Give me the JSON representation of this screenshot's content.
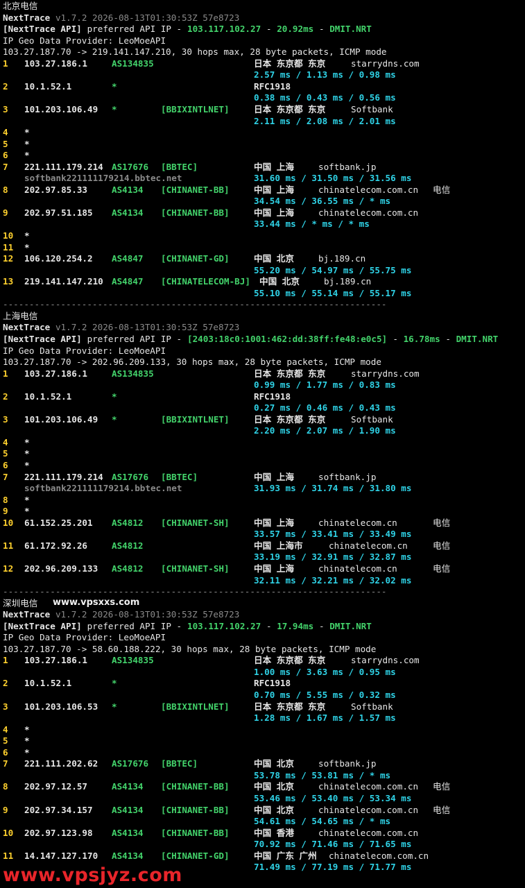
{
  "blocks": [
    {
      "title": "北京电信",
      "nt_name": "NextTrace",
      "nt_meta": "v1.7.2 2026-08-13T01:30:53Z 57e8723",
      "api_prefix": "[NextTrace API]",
      "api_text": " preferred API IP - ",
      "api_ip": "103.117.102.27",
      "api_sep": " - ",
      "api_ms": "20.92ms",
      "api_sep2": " - ",
      "api_node": "DMIT.NRT",
      "geo": "IP Geo Data Provider: LeoMoeAPI",
      "route": "103.27.187.70 -> 219.141.147.210, 30 hops max, 28 byte packets, ICMP mode",
      "hops": [
        {
          "n": "1",
          "ip": "103.27.186.1",
          "as": "AS134835",
          "tag": "",
          "loc": "日本 东京都 东京",
          "host": "starrydns.com",
          "extra": "",
          "rtt": "2.57 ms / 1.13 ms / 0.98 ms",
          "rdns": ""
        },
        {
          "n": "2",
          "ip": "10.1.52.1",
          "as": "*",
          "tag": "",
          "loc": "RFC1918",
          "host": "",
          "extra": "",
          "rtt": "0.38 ms / 0.43 ms / 0.56 ms",
          "rdns": ""
        },
        {
          "n": "3",
          "ip": "101.203.106.49",
          "as": "*",
          "tag": "[BBIXINTLNET]",
          "loc": "日本 东京都 东京",
          "host": "Softbank",
          "extra": "",
          "rtt": "2.11 ms / 2.08 ms / 2.01 ms",
          "rdns": ""
        },
        {
          "n": "4",
          "star": "*"
        },
        {
          "n": "5",
          "star": "*"
        },
        {
          "n": "6",
          "star": "*"
        },
        {
          "n": "7",
          "ip": "221.111.179.214",
          "as": "AS17676",
          "tag": "[BBTEC]",
          "loc": "中国 上海",
          "host": "softbank.jp",
          "extra": "",
          "rtt": "31.60 ms / 31.50 ms / 31.56 ms",
          "rdns": "softbank221111179214.bbtec.net"
        },
        {
          "n": "8",
          "ip": "202.97.85.33",
          "as": "AS4134",
          "tag": "[CHINANET-BB]",
          "loc": "中国 上海",
          "host": "chinatelecom.com.cn",
          "extra": "电信",
          "rtt": "34.54 ms / 36.55 ms / * ms",
          "rdns": ""
        },
        {
          "n": "9",
          "ip": "202.97.51.185",
          "as": "AS4134",
          "tag": "[CHINANET-BB]",
          "loc": "中国 上海",
          "host": "chinatelecom.com.cn",
          "extra": "",
          "rtt": "33.44 ms / * ms / * ms",
          "rdns": ""
        },
        {
          "n": "10",
          "star": "*"
        },
        {
          "n": "11",
          "star": "*"
        },
        {
          "n": "12",
          "ip": "106.120.254.2",
          "as": "AS4847",
          "tag": "[CHINANET-GD]",
          "loc": "中国 北京",
          "host": "bj.189.cn",
          "extra": "",
          "rtt": "55.20 ms / 54.97 ms / 55.75 ms",
          "rdns": ""
        },
        {
          "n": "13",
          "ip": "219.141.147.210",
          "as": "AS4847",
          "tag": "[CHINATELECOM-BJ]",
          "loc": "中国 北京",
          "host": "bj.189.cn",
          "extra": "",
          "rtt": "55.10 ms / 55.14 ms / 55.17 ms",
          "rdns": "",
          "wide": true
        }
      ]
    },
    {
      "title": "上海电信",
      "nt_name": "NextTrace",
      "nt_meta": "v1.7.2 2026-08-13T01:30:53Z 57e8723",
      "api_prefix": "[NextTrace API]",
      "api_text": " preferred API IP - ",
      "api_ip": "[2403:18c0:1001:462:dd:38ff:fe48:e0c5]",
      "api_sep": " - ",
      "api_ms": "16.78ms",
      "api_sep2": " - ",
      "api_node": "DMIT.NRT",
      "geo": "IP Geo Data Provider: LeoMoeAPI",
      "route": "103.27.187.70 -> 202.96.209.133, 30 hops max, 28 byte packets, ICMP mode",
      "hops": [
        {
          "n": "1",
          "ip": "103.27.186.1",
          "as": "AS134835",
          "tag": "",
          "loc": "日本 东京都 东京",
          "host": "starrydns.com",
          "extra": "",
          "rtt": "0.99 ms / 1.77 ms / 0.83 ms",
          "rdns": ""
        },
        {
          "n": "2",
          "ip": "10.1.52.1",
          "as": "*",
          "tag": "",
          "loc": "RFC1918",
          "host": "",
          "extra": "",
          "rtt": "0.27 ms / 0.46 ms / 0.43 ms",
          "rdns": ""
        },
        {
          "n": "3",
          "ip": "101.203.106.49",
          "as": "*",
          "tag": "[BBIXINTLNET]",
          "loc": "日本 东京都 东京",
          "host": "Softbank",
          "extra": "",
          "rtt": "2.20 ms / 2.07 ms / 1.90 ms",
          "rdns": ""
        },
        {
          "n": "4",
          "star": "*"
        },
        {
          "n": "5",
          "star": "*"
        },
        {
          "n": "6",
          "star": "*"
        },
        {
          "n": "7",
          "ip": "221.111.179.214",
          "as": "AS17676",
          "tag": "[BBTEC]",
          "loc": "中国 上海",
          "host": "softbank.jp",
          "extra": "",
          "rtt": "31.93 ms / 31.74 ms / 31.80 ms",
          "rdns": "softbank221111179214.bbtec.net"
        },
        {
          "n": "8",
          "star": "*"
        },
        {
          "n": "9",
          "star": "*"
        },
        {
          "n": "10",
          "ip": "61.152.25.201",
          "as": "AS4812",
          "tag": "[CHINANET-SH]",
          "loc": "中国 上海",
          "host": "chinatelecom.cn",
          "extra": "电信",
          "rtt": "33.57 ms / 33.41 ms / 33.49 ms",
          "rdns": ""
        },
        {
          "n": "11",
          "ip": "61.172.92.26",
          "as": "AS4812",
          "tag": "",
          "loc": "中国 上海市",
          "host": "chinatelecom.cn",
          "extra": "电信",
          "rtt": "33.19 ms / 32.91 ms / 32.87 ms",
          "rdns": "",
          "loc_wide": true
        },
        {
          "n": "12",
          "ip": "202.96.209.133",
          "as": "AS4812",
          "tag": "[CHINANET-SH]",
          "loc": "中国 上海",
          "host": "chinatelecom.cn",
          "extra": "电信",
          "rtt": "32.11 ms / 32.21 ms / 32.02 ms",
          "rdns": ""
        }
      ]
    },
    {
      "title": "深圳电信",
      "nt_name": "NextTrace",
      "nt_meta": "v1.7.2 2026-08-13T01:30:53Z 57e8723",
      "api_prefix": "[NextTrace API]",
      "api_text": " preferred API IP - ",
      "api_ip": "103.117.102.27",
      "api_sep": " - ",
      "api_ms": "17.94ms",
      "api_sep2": " - ",
      "api_node": "DMIT.NRT",
      "geo": "IP Geo Data Provider: LeoMoeAPI",
      "route": "103.27.187.70 -> 58.60.188.222, 30 hops max, 28 byte packets, ICMP mode",
      "hops": [
        {
          "n": "1",
          "ip": "103.27.186.1",
          "as": "AS134835",
          "tag": "",
          "loc": "日本 东京都 东京",
          "host": "starrydns.com",
          "extra": "",
          "rtt": "1.00 ms / 3.63 ms / 0.95 ms",
          "rdns": ""
        },
        {
          "n": "2",
          "ip": "10.1.52.1",
          "as": "*",
          "tag": "",
          "loc": "RFC1918",
          "host": "",
          "extra": "",
          "rtt": "0.70 ms / 5.55 ms / 0.32 ms",
          "rdns": ""
        },
        {
          "n": "3",
          "ip": "101.203.106.53",
          "as": "*",
          "tag": "[BBIXINTLNET]",
          "loc": "日本 东京都 东京",
          "host": "Softbank",
          "extra": "",
          "rtt": "1.28 ms / 1.67 ms / 1.57 ms",
          "rdns": ""
        },
        {
          "n": "4",
          "star": "*"
        },
        {
          "n": "5",
          "star": "*"
        },
        {
          "n": "6",
          "star": "*"
        },
        {
          "n": "7",
          "ip": "221.111.202.62",
          "as": "AS17676",
          "tag": "[BBTEC]",
          "loc": "中国 北京",
          "host": "softbank.jp",
          "extra": "",
          "rtt": "53.78 ms / 53.81 ms / * ms",
          "rdns": ""
        },
        {
          "n": "8",
          "ip": "202.97.12.57",
          "as": "AS4134",
          "tag": "[CHINANET-BB]",
          "loc": "中国 北京",
          "host": "chinatelecom.com.cn",
          "extra": "电信",
          "rtt": "53.46 ms / 53.40 ms / 53.34 ms",
          "rdns": ""
        },
        {
          "n": "9",
          "ip": "202.97.34.157",
          "as": "AS4134",
          "tag": "[CHINANET-BB]",
          "loc": "中国 北京",
          "host": "chinatelecom.com.cn",
          "extra": "电信",
          "rtt": "54.61 ms / 54.65 ms / * ms",
          "rdns": ""
        },
        {
          "n": "10",
          "ip": "202.97.123.98",
          "as": "AS4134",
          "tag": "[CHINANET-BB]",
          "loc": "中国 香港",
          "host": "chinatelecom.com.cn",
          "extra": "",
          "rtt": "70.92 ms / 71.46 ms / 71.65 ms",
          "rdns": ""
        },
        {
          "n": "11",
          "ip": "14.147.127.170",
          "as": "AS4134",
          "tag": "[CHINANET-GD]",
          "loc": "中国 广东 广州",
          "host": "chinatelecom.com.cn",
          "extra": "",
          "rtt": "71.49 ms / 77.19 ms / 71.77 ms",
          "rdns": "",
          "loc_wide": true
        }
      ]
    }
  ],
  "separator": "-------------------------------------------------------------------------",
  "watermark_small": "www.vpsxxs.com",
  "watermark_big": "www.vpsjyz.com"
}
